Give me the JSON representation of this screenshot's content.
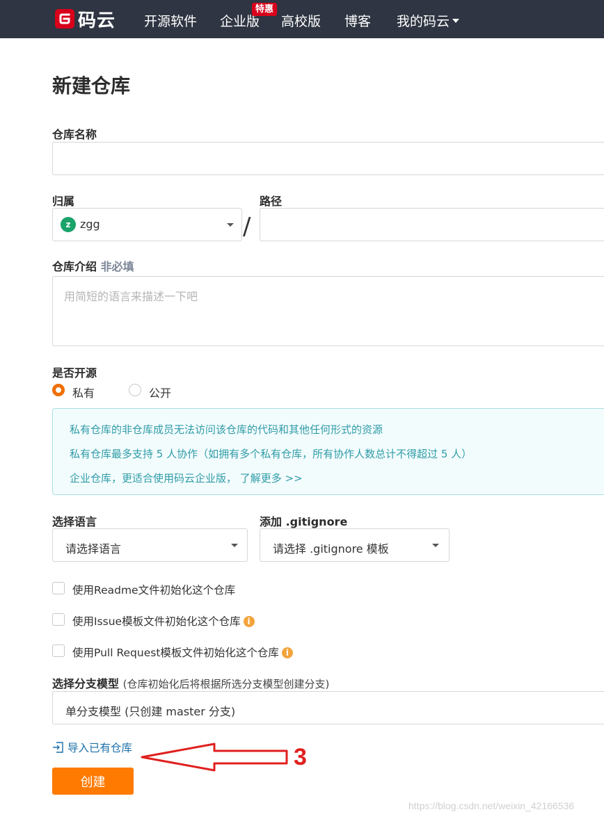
{
  "nav": {
    "logo_text": "码云",
    "items": [
      "开源软件",
      "企业版",
      "高校版",
      "博客",
      "我的码云"
    ],
    "badge": "特惠"
  },
  "page": {
    "title": "新建仓库"
  },
  "form": {
    "repo_name_label": "仓库名称",
    "repo_name_value": "",
    "owner_label": "归属",
    "owner_avatar_letter": "z",
    "owner_value": "zgg",
    "path_label": "路径",
    "path_value": "",
    "desc_label": "仓库介绍",
    "desc_optional": "非必填",
    "desc_placeholder": "用简短的语言来描述一下吧",
    "open_source_label": "是否开源",
    "radio_private": "私有",
    "radio_public": "公开",
    "info_lines": [
      "私有仓库的非仓库成员无法访问该仓库的代码和其他任何形式的资源",
      "私有仓库最多支持 5 人协作（如拥有多个私有仓库，所有协作人数总计不得超过 5 人）",
      "企业仓库，更适合使用码云企业版， 了解更多 >>"
    ],
    "language_label": "选择语言",
    "language_value": "请选择语言",
    "gitignore_label": "添加 .gitignore",
    "gitignore_value": "请选择 .gitignore 模板",
    "check_readme": "使用Readme文件初始化这个仓库",
    "check_issue": "使用Issue模板文件初始化这个仓库",
    "check_pr": "使用Pull Request模板文件初始化这个仓库",
    "branch_label": "选择分支模型",
    "branch_hint": "(仓库初始化后将根据所选分支模型创建分支)",
    "branch_value": "单分支模型 (只创建 master 分支)",
    "import_link": "导入已有仓库",
    "create_button": "创建"
  },
  "annotation": {
    "number": "3"
  },
  "watermark": "https://blog.csdn.net/weixin_42166536",
  "colors": {
    "nav_bg": "#2f3542",
    "accent_orange": "#ff7a00",
    "brand_red": "#d9001b",
    "info_text": "#2f9ca8",
    "annotation_red": "#e0201e"
  }
}
